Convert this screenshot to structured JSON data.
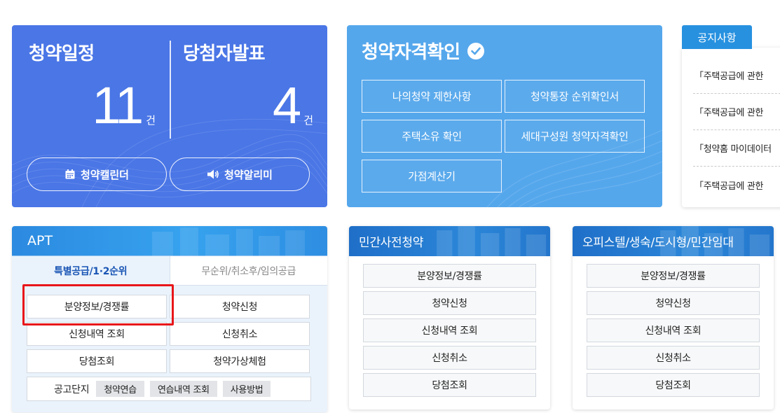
{
  "schedule": {
    "title": "청약일정",
    "count": "11",
    "unit": "건",
    "calendar_label": "청약캘린더"
  },
  "announcement": {
    "title": "당첨자발표",
    "count": "4",
    "unit": "건",
    "alarm_label": "청약알리미"
  },
  "qualification": {
    "title": "청약자격확인",
    "buttons": [
      "나의청약 제한사항",
      "청약통장 순위확인서",
      "주택소유 확인",
      "세대구성원 청약자격확인",
      "가점계산기"
    ]
  },
  "notice": {
    "tab_label": "공지사항",
    "items": [
      "「주택공급에 관한",
      "「주택공급에 관한",
      "「청약홈 마이데이터",
      "「주택공급에 관한"
    ]
  },
  "apt": {
    "title": "APT",
    "tabs": [
      "특별공급/1·2순위",
      "무순위/취소후/임의공급"
    ],
    "buttons": [
      "분양정보/경쟁률",
      "청약신청",
      "신청내역 조회",
      "신청취소",
      "당첨조회",
      "청약가상체험"
    ],
    "bottom_label": "공고단지",
    "bottom_buttons": [
      "청약연습",
      "연습내역 조회",
      "사용방법"
    ]
  },
  "private": {
    "title": "민간사전청약",
    "buttons": [
      "분양정보/경쟁률",
      "청약신청",
      "신청내역 조회",
      "신청취소",
      "당첨조회"
    ]
  },
  "officetel": {
    "title": "오피스텔/생숙/도시형/민간임대",
    "buttons": [
      "분양정보/경쟁률",
      "청약신청",
      "신청내역 조회",
      "신청취소",
      "당첨조회"
    ]
  },
  "colors": {
    "schedule_bg": "#4a76e6",
    "qualification_bg": "#55a7ec",
    "notice_tab": "#2791e0",
    "header_blue": "#2b86d8",
    "highlight_red": "#e8161a"
  }
}
